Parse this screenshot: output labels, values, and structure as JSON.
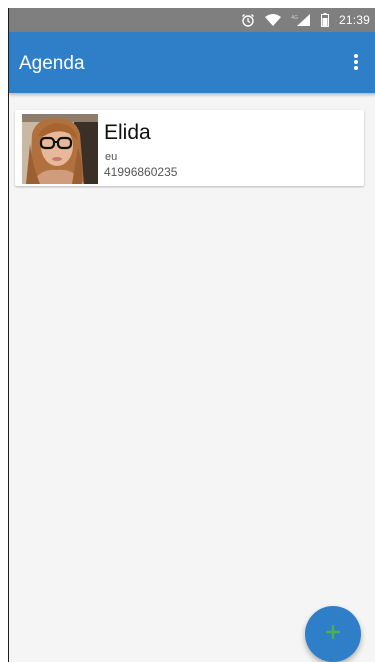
{
  "status_bar": {
    "time": "21:39",
    "icons": [
      "alarm-icon",
      "wifi-icon",
      "signal-icon",
      "battery-icon"
    ]
  },
  "app_bar": {
    "title": "Agenda",
    "menu_icon": "more-vert-icon"
  },
  "contacts": [
    {
      "name": "Elida",
      "note": "eu",
      "phone": "41996860235",
      "avatar": "contact-photo"
    }
  ],
  "fab": {
    "icon": "plus-icon",
    "color": "#2f7fc8",
    "icon_color": "#4caf50"
  },
  "colors": {
    "primary": "#2f7fc8",
    "status_bar": "#7f7f7f",
    "background": "#f5f5f5"
  }
}
